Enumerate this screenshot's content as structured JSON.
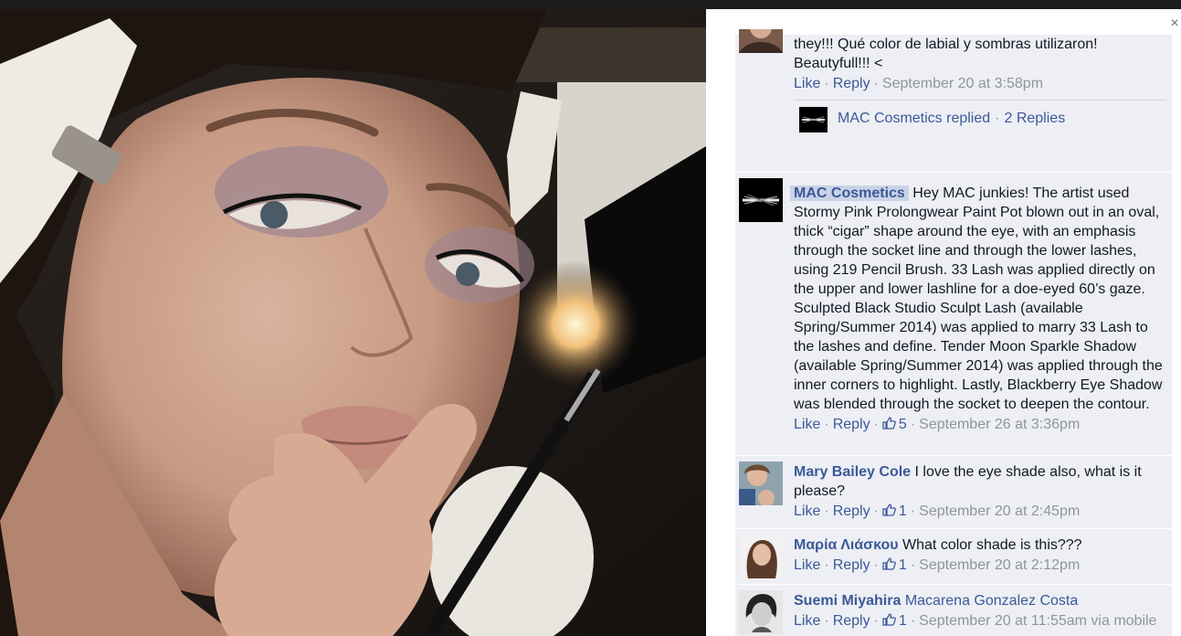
{
  "window": {
    "faint_top_text": "",
    "close_glyph": "×"
  },
  "photo": {
    "alt": "",
    "accent": "#f2c07a"
  },
  "comments": [
    {
      "author": "",
      "text": "they!!! Qué color de labial y sombras utilizaron! Beautyfull!!! <",
      "like_label": "Like",
      "reply_label": "Reply",
      "likes": "",
      "timestamp": "September 20 at 3:58pm",
      "replies": {
        "author": "MAC Cosmetics replied",
        "count_label": "2 Replies"
      }
    },
    {
      "author": "MAC Cosmetics",
      "text": "Hey MAC junkies! The artist used Stormy Pink Prolongwear Paint Pot blown out in an oval, thick “cigar” shape around the eye, with an emphasis through the socket line and through the lower lashes, using 219 Pencil Brush. 33 Lash was applied directly on the upper and lower lashline for a doe-eyed 60’s gaze. Sculpted Black Studio Sculpt Lash (available Spring/Summer 2014) was applied to marry 33 Lash to the lashes and define. Tender Moon Sparkle Shadow (available Spring/Summer 2014) was applied through the inner corners to highlight. Lastly, Blackberry Eye Shadow was blended through the socket to deepen the contour.",
      "like_label": "Like",
      "reply_label": "Reply",
      "likes": "5",
      "timestamp": "September 26 at 3:36pm"
    },
    {
      "author": "Mary Bailey Cole",
      "text": "I love the eye shade also, what is it please?",
      "like_label": "Like",
      "reply_label": "Reply",
      "likes": "1",
      "timestamp": "September 20 at 2:45pm"
    },
    {
      "author": "Μαρία Λιάσκου",
      "text": "What color shade is this???",
      "like_label": "Like",
      "reply_label": "Reply",
      "likes": "1",
      "timestamp": "September 20 at 2:12pm"
    },
    {
      "author": "Suemi Miyahira",
      "text": "Macarena Gonzalez Costa",
      "text_is_link": true,
      "like_label": "Like",
      "reply_label": "Reply",
      "likes": "1",
      "timestamp": "September 20 at 11:55am via mobile"
    }
  ],
  "colors": {
    "link": "#3b5998",
    "comment_bg": "#edeff4",
    "meta": "#90949c"
  }
}
